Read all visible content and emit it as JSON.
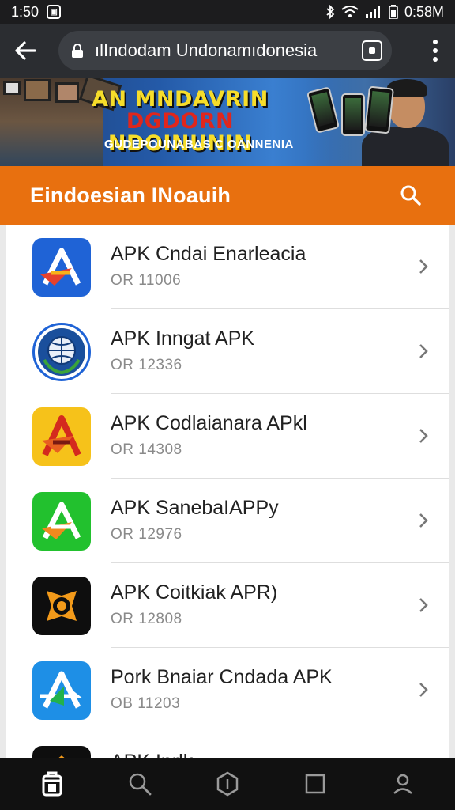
{
  "status_bar": {
    "time_left": "1:50",
    "time_right": "0:58M",
    "icons": [
      "notification-icon",
      "bluetooth-icon",
      "wifi-icon",
      "signal-icon",
      "battery-icon"
    ]
  },
  "browser": {
    "url": "ılIndodam Undonamıdonesia"
  },
  "banner": {
    "headline_line1": "AN MNDAVRIN",
    "headline_line2_red": "DGDORN",
    "headline_line2_yellow": "NDOINUNIN",
    "subtitle": "GUDEPOUNABAS C OANNENIA"
  },
  "header": {
    "title": "Eindoesian INoauih"
  },
  "apps": [
    {
      "name": "APK Cndai Enarleacia",
      "code": "OR 11006",
      "icon": "blue-a-icon"
    },
    {
      "name": "APK Inngat APK",
      "code": "OR 12336",
      "icon": "globe-emblem-icon"
    },
    {
      "name": "APK Codlaianara APkl",
      "code": "OR 14308",
      "icon": "yellow-a-icon"
    },
    {
      "name": "APK SanebaIAPPy",
      "code": "OR 12976",
      "icon": "green-a-icon"
    },
    {
      "name": "APK Coitkiak APR)",
      "code": "OR 12808",
      "icon": "orange-gear-icon"
    },
    {
      "name": "Pork Bnaiar Cndada APK",
      "code": "OB 11203",
      "icon": "blue-arrow-a-icon"
    },
    {
      "name": "APK Inrlk",
      "code": "",
      "icon": "dark-app-icon"
    }
  ],
  "colors": {
    "accent": "#e8700f",
    "status_bar": "#1c1c1e",
    "browser_bar": "#2b2d31",
    "nav": "#111111"
  }
}
